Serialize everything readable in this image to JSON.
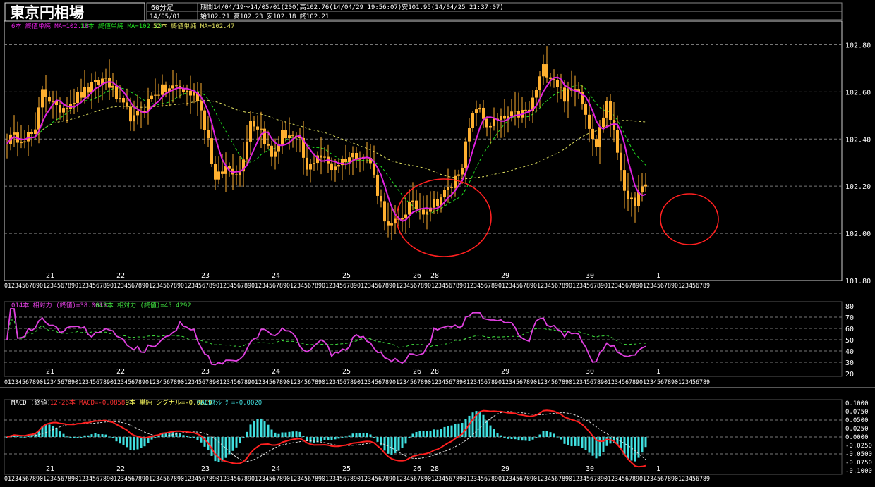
{
  "header": {
    "title": "東京円相場",
    "interval": "60分足",
    "period_line": "期間14/04/19～14/05/01(200)高102.76(14/04/29 19:56:07)安101.95(14/04/25 21:37:07)",
    "date": "14/05/01",
    "ohlc_line": "始102.21 高102.23 安102.18 終102.21"
  },
  "colors": {
    "bg": "#000000",
    "grid": "#777777",
    "candle": "#ffb030",
    "ma_short": "#e020e0",
    "ma_mid": "#20e020",
    "ma_long": "#e0e060",
    "rsi": "#e040e0",
    "rsi_avg": "#40e040",
    "macd": "#ff2020",
    "signal": "#e0e0e0",
    "osc": "#40e0e0",
    "highlight_circle": "#ff2020",
    "panel_border": "#e00000"
  },
  "chart_data": [
    {
      "type": "candlestick",
      "legend": [
        {
          "text": "6本 終値単純 MA=102.18",
          "color": "#e020e0"
        },
        {
          "text": "13本 終値単純 MA=102.25",
          "color": "#20e020"
        },
        {
          "text": "52本 終値単純 MA=102.47",
          "color": "#e0e060"
        }
      ],
      "ylim": [
        101.8,
        102.9
      ],
      "yticks": [
        "102.80",
        "102.60",
        "102.40",
        "102.20",
        "102.00",
        "101.80"
      ],
      "grid_values": [
        102.8,
        102.6,
        102.4,
        102.2,
        102.0
      ],
      "day_labels": [
        "21",
        "22",
        "23",
        "24",
        "25",
        "26",
        "28",
        "29",
        "30",
        "1"
      ],
      "day_positions": [
        7,
        27,
        51,
        71,
        91,
        111,
        116,
        136,
        160,
        180
      ],
      "n_bars": 200,
      "hour_digits": "0123456789",
      "close_anchors": [
        [
          0,
          102.4
        ],
        [
          8,
          102.42
        ],
        [
          10,
          102.62
        ],
        [
          14,
          102.52
        ],
        [
          20,
          102.58
        ],
        [
          28,
          102.66
        ],
        [
          32,
          102.55
        ],
        [
          36,
          102.48
        ],
        [
          42,
          102.6
        ],
        [
          48,
          102.62
        ],
        [
          54,
          102.58
        ],
        [
          57,
          102.4
        ],
        [
          59,
          102.22
        ],
        [
          62,
          102.28
        ],
        [
          66,
          102.26
        ],
        [
          69,
          102.48
        ],
        [
          72,
          102.44
        ],
        [
          75,
          102.32
        ],
        [
          78,
          102.42
        ],
        [
          80,
          102.42
        ],
        [
          83,
          102.38
        ],
        [
          85,
          102.26
        ],
        [
          88,
          102.34
        ],
        [
          92,
          102.28
        ],
        [
          96,
          102.32
        ],
        [
          100,
          102.34
        ],
        [
          103,
          102.3
        ],
        [
          105,
          102.18
        ],
        [
          108,
          102.02
        ],
        [
          111,
          102.05
        ],
        [
          114,
          102.12
        ],
        [
          118,
          102.1
        ],
        [
          122,
          102.14
        ],
        [
          126,
          102.2
        ],
        [
          129,
          102.3
        ],
        [
          131,
          102.44
        ],
        [
          133,
          102.54
        ],
        [
          136,
          102.46
        ],
        [
          140,
          102.48
        ],
        [
          144,
          102.5
        ],
        [
          148,
          102.52
        ],
        [
          152,
          102.7
        ],
        [
          155,
          102.66
        ],
        [
          158,
          102.58
        ],
        [
          162,
          102.62
        ],
        [
          165,
          102.46
        ],
        [
          167,
          102.38
        ],
        [
          170,
          102.56
        ],
        [
          172,
          102.42
        ],
        [
          174,
          102.28
        ],
        [
          176,
          102.12
        ],
        [
          178,
          102.14
        ],
        [
          181,
          102.2
        ]
      ]
    },
    {
      "type": "line",
      "legend": [
        {
          "text": "014本 相対力 (終値)=38.0613",
          "color": "#e040e0"
        },
        {
          "text": "042本 相対力 (終値)=45.4292",
          "color": "#40e040"
        }
      ],
      "ylim": [
        20,
        80
      ],
      "yticks": [
        "80",
        "70",
        "60",
        "50",
        "40",
        "30",
        "20"
      ],
      "grid_values": [
        70,
        60,
        50,
        40,
        30
      ]
    },
    {
      "type": "line",
      "legend": [
        {
          "text": "MACD (終値)",
          "color": "#ffffff"
        },
        {
          "text": "12-26本 MACD=-0.0858",
          "color": "#ff3030"
        },
        {
          "text": "9本 単純 シグナル=-0.0839",
          "color": "#ffff60"
        },
        {
          "text": "MACDｵｼﾚｰﾀｰ=-0.0020",
          "color": "#40e0e0"
        }
      ],
      "ylim": [
        -0.1,
        0.1
      ],
      "yticks": [
        "0.1000",
        "0.0750",
        "0.0500",
        "0.0250",
        "0.0000",
        "-0.0250",
        "-0.0500",
        "-0.0750",
        "-0.1000"
      ],
      "grid_values": [
        0.05,
        0.0,
        -0.05
      ]
    }
  ]
}
